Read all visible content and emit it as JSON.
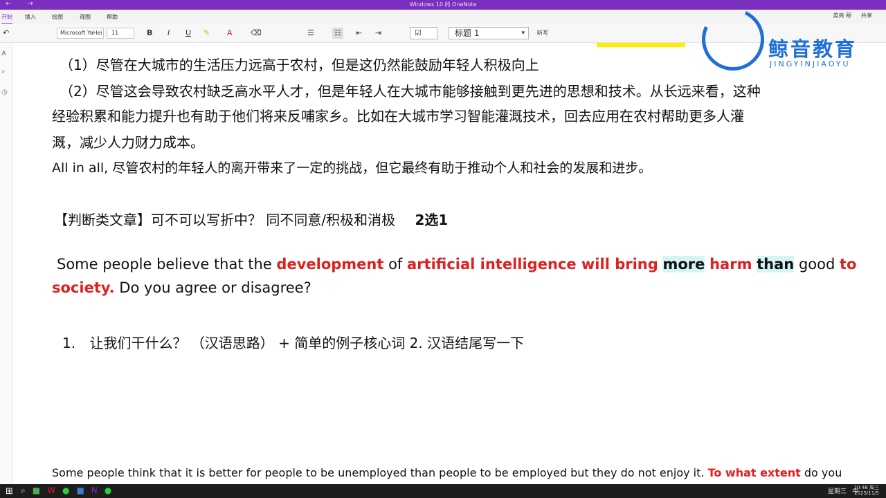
{
  "window": {
    "title": "Windows 10 的 OneNote",
    "nav_arrows": "← →"
  },
  "tabs": {
    "start": "开始",
    "insert": "插入",
    "draw": "绘图",
    "view": "视图",
    "help": "帮助",
    "user": "英亮 穆",
    "share": "共享"
  },
  "ribbon": {
    "font": "Microsoft YaHei",
    "size": "11",
    "bold": "B",
    "italic": "I",
    "underline": "U",
    "style": "标题 1",
    "listen": "听写"
  },
  "notes": {
    "p1": "（1）尽管在大城市的生活压力远高于农村，但是这仍然能鼓励年轻人积极向上",
    "p2a": "（2）尽管这会导致农村缺乏高水平人才，但是年轻人在大城市能够接触到更先进的思想和技术。从长远来看，这种",
    "p2b": "经验积累和能力提升也有助于他们将来反哺家乡。比如在大城市学习智能灌溉技术，回去应用在农村帮助更多人灌",
    "p2c": "溉，减少人力财力成本。",
    "conclusion": "All in all, 尽管农村的年轻人的离开带来了一定的挑战，但它最终有助于推动个人和社会的发展和进步。",
    "judge_label": "【判断类文章】可不可以写折中？ 同不同意/积极和消极",
    "choose": "2选1",
    "q_a": "Some people believe that the ",
    "q_dev": "development",
    "q_of": " of ",
    "q_ai": "artificial intelligence will bring",
    "q_more": "more",
    "q_harm": "harm",
    "q_than": "than",
    "q_good": " good ",
    "q_to": "to",
    "q_society": "society.",
    "q_end": " Do you agree or disagree?",
    "step_num": "1.",
    "step_text": "让我们干什么？ （汉语思路） + 简单的例子核心词  2. 汉语结尾写一下",
    "bottom_a": "Some people think that it is better for people to be unemployed than people to be employed but they do not enjoy it. ",
    "bottom_ext": "To what extent",
    "bottom_b": " do you"
  },
  "logo": {
    "name": "鲸音教育",
    "pinyin": "JINGYINJIAOYU"
  },
  "taskbar": {
    "time": "20:48 周三",
    "date": "2025/11/5",
    "day": "星期三",
    "lang": "中"
  },
  "colors": {
    "accent": "#7b2fbe",
    "red": "#e02020",
    "highlight": "#d5f5f5",
    "logo_blue": "#1f6fd9"
  }
}
